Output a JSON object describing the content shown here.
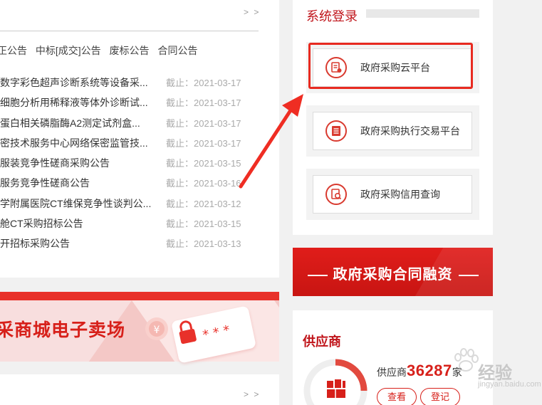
{
  "notices": {
    "more": "> >",
    "tabs": [
      "正公告",
      "中标[成交]公告",
      "废标公告",
      "合同公告"
    ],
    "rows": [
      {
        "title": "数字彩色超声诊断系统等设备采...",
        "deadline": "截止：2021-03-17"
      },
      {
        "title": "细胞分析用稀释液等体外诊断试...",
        "deadline": "截止：2021-03-17"
      },
      {
        "title": "蛋白相关磷脂酶A2测定试剂盒...",
        "deadline": "截止：2021-03-17"
      },
      {
        "title": "密技术服务中心网络保密监管技...",
        "deadline": "截止：2021-03-17"
      },
      {
        "title": "服装竞争性磋商采购公告",
        "deadline": "截止：2021-03-15"
      },
      {
        "title": "服务竞争性磋商公告",
        "deadline": "截止：2021-03-16"
      },
      {
        "title": "学附属医院CT维保竞争性谈判公...",
        "deadline": "截止：2021-03-12"
      },
      {
        "title": "舱CT采购招标公告",
        "deadline": "截止：2021-03-15"
      },
      {
        "title": "开招标采购公告",
        "deadline": "截止：2021-03-13"
      }
    ]
  },
  "mall_banner": {
    "title": "采商城电子卖场"
  },
  "bottom_panel": {
    "more": "> >"
  },
  "login": {
    "title": "系统登录",
    "options": [
      {
        "label": "政府采购云平台",
        "icon": "cloud-doc-icon"
      },
      {
        "label": "政府采购执行交易平台",
        "icon": "trade-doc-icon"
      },
      {
        "label": "政府采购信用查询",
        "icon": "credit-search-icon"
      }
    ]
  },
  "finance_banner": {
    "title": "政府采购合同融资"
  },
  "supplier": {
    "title": "供应商",
    "count_prefix": "供应商",
    "count": "36287",
    "count_suffix": "家",
    "view_label": "查看",
    "register_label": "登记"
  },
  "watermark": {
    "text": "经验",
    "sub": "jingyan.baidu.com"
  },
  "colors": {
    "brand_red": "#d7201a",
    "highlight": "#e82a20"
  }
}
